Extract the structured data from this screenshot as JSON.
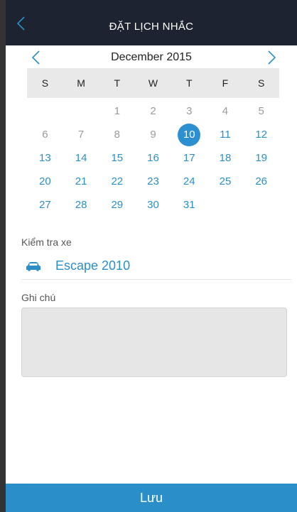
{
  "header": {
    "title": "ĐẶT LỊCH NHẮC"
  },
  "calendar": {
    "month_label": "December 2015",
    "weekdays": [
      "S",
      "M",
      "T",
      "W",
      "T",
      "F",
      "S"
    ],
    "weeks": [
      [
        "",
        "",
        "1",
        "2",
        "3",
        "4",
        "5"
      ],
      [
        "6",
        "7",
        "8",
        "9",
        "10",
        "11",
        "12"
      ],
      [
        "13",
        "14",
        "15",
        "16",
        "17",
        "18",
        "19"
      ],
      [
        "20",
        "21",
        "22",
        "23",
        "24",
        "25",
        "26"
      ],
      [
        "27",
        "28",
        "29",
        "30",
        "31",
        "",
        ""
      ]
    ],
    "selected_day": "10",
    "colors": {
      "past": "#9a9a9a",
      "future": "#2a8fc8",
      "selected": "#2b8fd0"
    }
  },
  "vehicle": {
    "label": "Kiểm tra xe",
    "name": "Escape 2010",
    "icon": "car-icon"
  },
  "notes": {
    "label": "Ghi chú",
    "value": ""
  },
  "save": {
    "label": "Lưu"
  },
  "colors": {
    "accent": "#2a8fc8",
    "navbar": "#1d2331"
  }
}
